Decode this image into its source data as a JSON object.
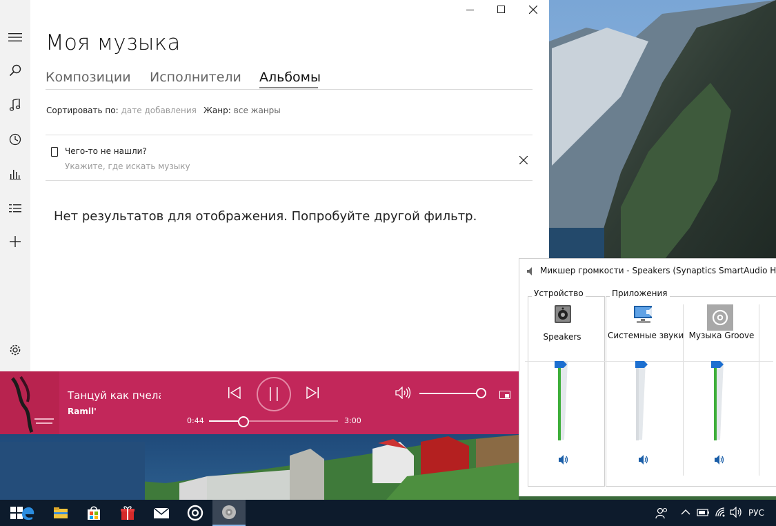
{
  "app": {
    "title": "Моя музыка",
    "tabs": [
      {
        "label": "Композиции",
        "active": false
      },
      {
        "label": "Исполнители",
        "active": false
      },
      {
        "label": "Альбомы",
        "active": true
      }
    ],
    "sort": {
      "label": "Сортировать по:",
      "value": "дате добавления"
    },
    "genre": {
      "label": "Жанр:",
      "value": "все жанры"
    },
    "notice": {
      "title": "Чего-то не нашли?",
      "subtitle": "Укажите, где искать музыку"
    },
    "empty_message": "Нет результатов для отображения. Попробуйте другой фильтр."
  },
  "nav_icons": [
    "hamburger-icon",
    "search-icon",
    "music-note-icon",
    "recent-icon",
    "now-playing-icon",
    "playlist-icon",
    "add-icon",
    "settings-icon"
  ],
  "player": {
    "track_title": "Танцуй как пчела",
    "artist": "Ramil'",
    "elapsed": "0:44",
    "total": "3:00",
    "progress": 0.27,
    "volume": 1.0,
    "accent": "#c2275a"
  },
  "mixer": {
    "title": "Микшер громкости - Speakers (Synaptics SmartAudio HD)",
    "device_group": "Устройство",
    "apps_group": "Приложения",
    "channels": [
      {
        "name": "Speakers",
        "level": 1.0,
        "icon": "speaker-icon"
      },
      {
        "name": "Системные звуки",
        "level": 1.0,
        "icon": "system-sounds-icon"
      },
      {
        "name": "Музыка Groove",
        "level": 1.0,
        "icon": "groove-icon"
      }
    ]
  },
  "taskbar": {
    "apps": [
      "edge-icon",
      "file-explorer-icon",
      "store-icon",
      "gift-icon",
      "mail-icon",
      "groove-music-icon",
      "volume-mixer-icon"
    ],
    "language": "РУС"
  }
}
